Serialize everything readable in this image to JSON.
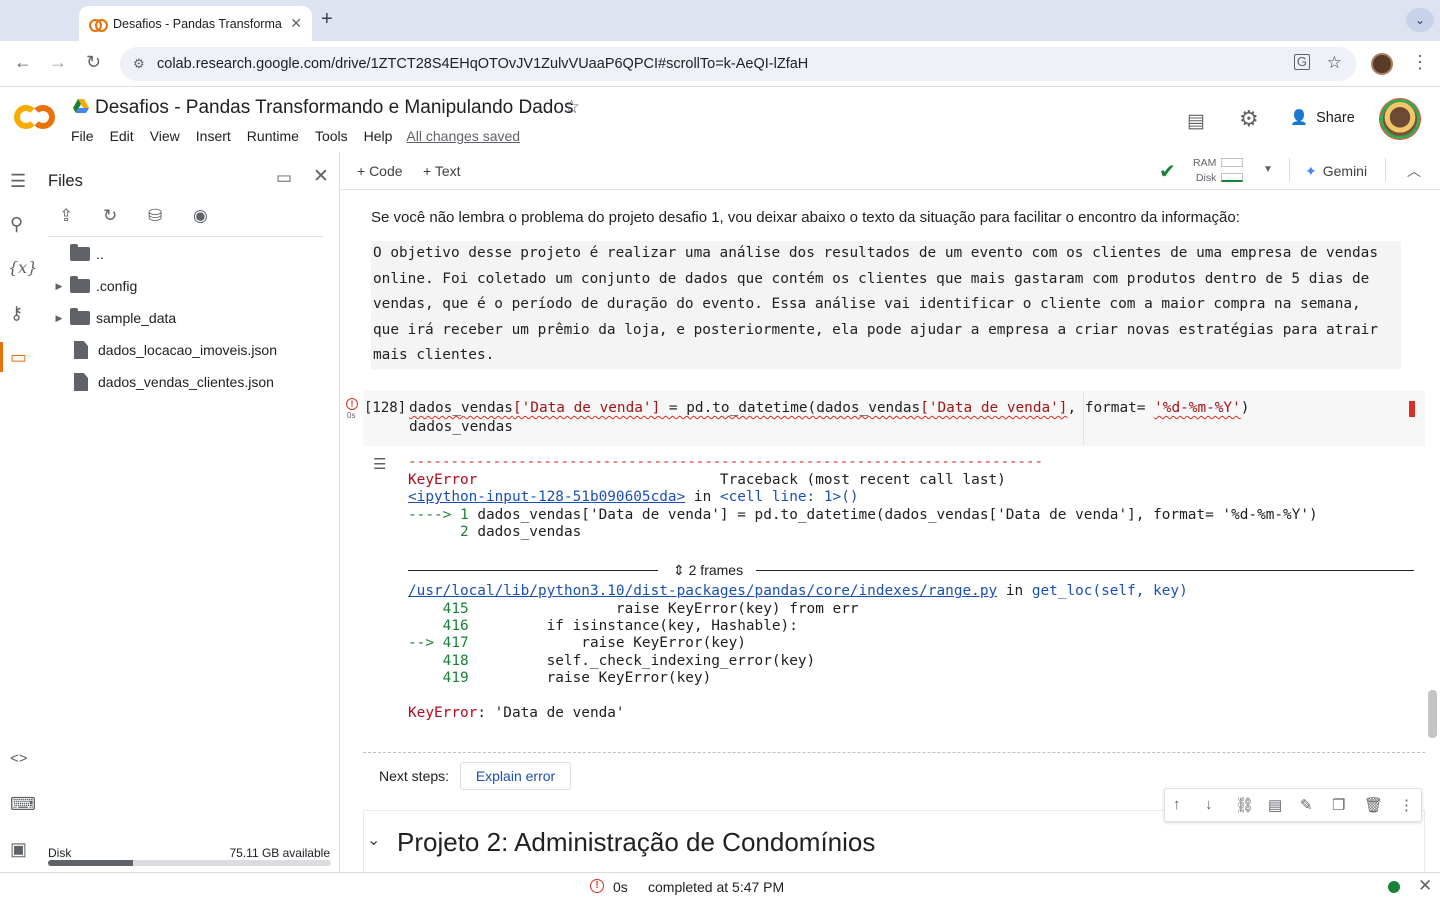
{
  "browser": {
    "tab_title": "Desafios - Pandas Transforma",
    "tab_close": "✕",
    "new_tab": "+",
    "url": "colab.research.google.com/drive/1ZTCT28S4EHqOTOvJV1ZulvVUaaP6QPCI#scrollTo=k-AeQI-lZfaH"
  },
  "header": {
    "title": "Desafios - Pandas Transformando e Manipulando Dados",
    "menu": [
      "File",
      "Edit",
      "View",
      "Insert",
      "Runtime",
      "Tools",
      "Help"
    ],
    "saved_status": "All changes saved",
    "share_label": "Share"
  },
  "files_panel": {
    "title": "Files",
    "items": [
      {
        "name": "..",
        "kind": "folder-up"
      },
      {
        "name": ".config",
        "kind": "folder"
      },
      {
        "name": "sample_data",
        "kind": "folder"
      },
      {
        "name": "dados_locacao_imoveis.json",
        "kind": "file"
      },
      {
        "name": "dados_vendas_clientes.json",
        "kind": "file"
      }
    ],
    "disk_label": "Disk",
    "disk_available": "75.11 GB available",
    "disk_used_fraction": 0.3
  },
  "nb_toolbar": {
    "code_label": "+ Code",
    "text_label": "+ Text",
    "ram_label": "RAM",
    "disk_label": "Disk",
    "gemini_label": "Gemini"
  },
  "notebook": {
    "intro_text": "Se você não lembra o problema do projeto desafio 1, vou deixar abaixo o texto da situação para facilitar o encontro da informação:",
    "quote_lines": [
      " O objetivo desse projeto é realizar uma análise dos resultados de um evento com os clientes de uma empresa de vendas",
      " online. Foi coletado um conjunto de dados que contém os clientes que mais gastaram com produtos dentro de 5 dias de",
      " vendas, que é o período de duração do evento. Essa análise vai identificar o cliente com a maior compra na semana,",
      " que irá receber um prêmio da loja, e posteriormente, ela pode ajudar a empresa a criar novas estratégias para atrair",
      " mais clientes."
    ],
    "cell": {
      "exec_count": "[128]",
      "exec_time": "0s",
      "line1_a": "dados_vendas",
      "line1_b": "['Data de venda']",
      "line1_c": " = pd.to_datetime(dados_vendas",
      "line1_d": "['Data de venda']",
      "line1_e": ", format= ",
      "line1_f": "'%d-%m-%Y'",
      "line1_g": ")",
      "line2": "dados_vendas"
    },
    "traceback": {
      "dashes": "---------------------------------------------------------------------------",
      "error_name": "KeyError",
      "header_right": "                            Traceback (most recent call last)",
      "input_link": "<ipython-input-128-51b090605cda>",
      "in_text": " in ",
      "cell_ref": "<cell line: 1>()",
      "arrow1": "----> 1 ",
      "arrow1_code": "dados_vendas['Data de venda'] = pd.to_datetime(dados_vendas['Data de venda'], format= '%d-%m-%Y')",
      "line2_num": "      2 ",
      "line2_code": "dados_vendas",
      "frames_label": "2 frames",
      "path_link": "/usr/local/lib/python3.10/dist-packages/pandas/core/indexes/range.py",
      "path_in": " in ",
      "func": "get_loc(self, key)",
      "src": [
        {
          "num": "    415 ",
          "code": "                raise KeyError(key) from err"
        },
        {
          "num": "    416 ",
          "code": "        if isinstance(key, Hashable):"
        },
        {
          "num": "--> 417 ",
          "code": "            raise KeyError(key)"
        },
        {
          "num": "    418 ",
          "code": "        self._check_indexing_error(key)"
        },
        {
          "num": "    419 ",
          "code": "        raise KeyError(key)"
        }
      ],
      "final_name": "KeyError",
      "final_msg": ": 'Data de venda'"
    },
    "next_steps_label": "Next steps:",
    "explain_button": "Explain error",
    "section_heading": "Projeto 2: Administração de Condomínios"
  },
  "statusbar": {
    "exec_time": "0s",
    "completed": "completed at 5:47 PM"
  },
  "colors": {
    "accent": "#e8710a",
    "error": "#d93025",
    "ok": "#188038",
    "link": "#1a4fb8"
  }
}
